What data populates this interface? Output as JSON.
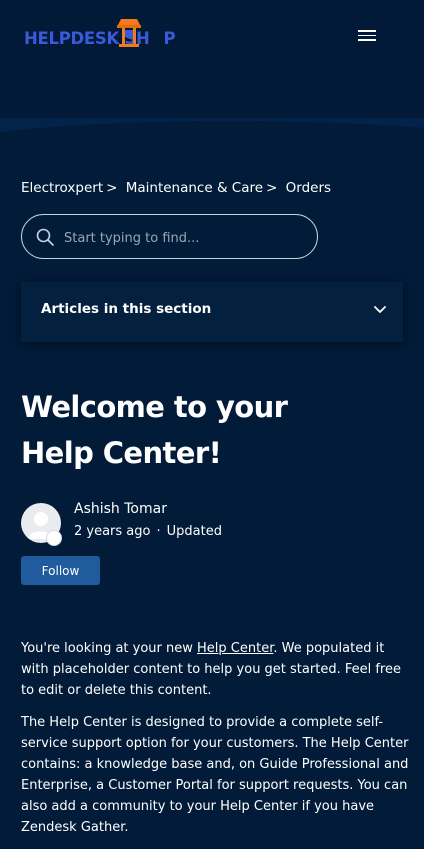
{
  "header": {
    "logo_text_left": "HELPDESK SH",
    "logo_text_right": "P",
    "menu_icon": "hamburger-icon",
    "brand_color": "#3a5bd9",
    "accent_color": "#f07d1a"
  },
  "breadcrumb": [
    {
      "label": "Electroxpert",
      "sep": ">"
    },
    {
      "label": "Maintenance & Care",
      "sep": ">"
    },
    {
      "label": "Orders",
      "sep": ""
    }
  ],
  "search": {
    "placeholder": "Start typing to find...",
    "value": ""
  },
  "articles_section": {
    "label": "Articles in this section"
  },
  "article": {
    "title": "Welcome to your Help Center!",
    "author": "Ashish Tomar",
    "posted": "2 years ago",
    "dot": "·",
    "updated": "Updated",
    "follow_label": "Follow",
    "p1_before": "You're looking at your new ",
    "p1_link": "Help Center",
    "p1_after": ". We populated it with placeholder content to help you get started. Feel free to edit or delete this content.",
    "p2": "The Help Center is designed to provide a complete self-service support option for your customers. The Help Center contains: a knowledge base and, on Guide Professional and Enterprise, a Customer Portal for support requests. You can also add a community to your Help Center if you have Zendesk Gather."
  }
}
